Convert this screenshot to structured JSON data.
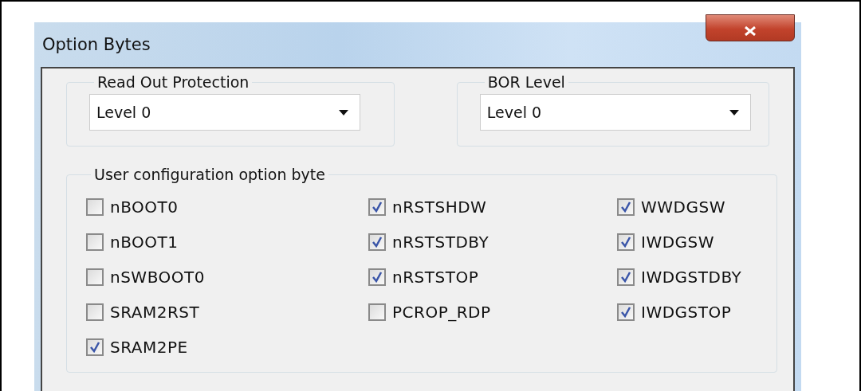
{
  "window": {
    "title": "Option Bytes"
  },
  "read_out_protection": {
    "label": "Read Out Protection",
    "value": "Level 0"
  },
  "bor_level": {
    "label": "BOR Level",
    "value": "Level 0"
  },
  "user_configuration": {
    "label": "User configuration option byte",
    "columns": [
      [
        {
          "label": "nBOOT0",
          "checked": false
        },
        {
          "label": "nBOOT1",
          "checked": false
        },
        {
          "label": "nSWBOOT0",
          "checked": false
        },
        {
          "label": "SRAM2RST",
          "checked": false
        },
        {
          "label": "SRAM2PE",
          "checked": true
        }
      ],
      [
        {
          "label": "nRSTSHDW",
          "checked": true
        },
        {
          "label": "nRSTSTDBY",
          "checked": true
        },
        {
          "label": "nRSTSTOP",
          "checked": true
        },
        {
          "label": "PCROP_RDP",
          "checked": false
        }
      ],
      [
        {
          "label": "WWDGSW",
          "checked": true
        },
        {
          "label": "IWDGSW",
          "checked": true
        },
        {
          "label": "IWDGSTDBY",
          "checked": true
        },
        {
          "label": "IWDGSTOP",
          "checked": true
        }
      ]
    ]
  }
}
